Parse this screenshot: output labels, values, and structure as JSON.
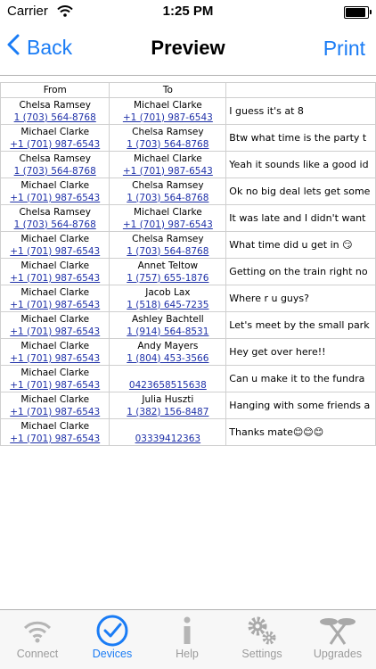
{
  "status_bar": {
    "carrier": "Carrier",
    "time": "1:25 PM"
  },
  "nav": {
    "back_label": "Back",
    "title": "Preview",
    "print_label": "Print"
  },
  "table": {
    "headers": [
      "From",
      "To",
      ""
    ],
    "rows": [
      {
        "from_name": "Chelsa Ramsey",
        "from_number": "1 (703) 564-8768",
        "to_name": "Michael Clarke",
        "to_number": "+1 (701) 987-6543",
        "message": "I guess it's at 8"
      },
      {
        "from_name": "Michael Clarke",
        "from_number": "+1 (701) 987-6543",
        "to_name": "Chelsa Ramsey",
        "to_number": "1 (703) 564-8768",
        "message": "Btw what time is the party t"
      },
      {
        "from_name": "Chelsa Ramsey",
        "from_number": "1 (703) 564-8768",
        "to_name": "Michael Clarke",
        "to_number": "+1 (701) 987-6543",
        "message": "Yeah it sounds like a good id"
      },
      {
        "from_name": "Michael Clarke",
        "from_number": "+1 (701) 987-6543",
        "to_name": "Chelsa Ramsey",
        "to_number": "1 (703) 564-8768",
        "message": "Ok no big deal lets get some"
      },
      {
        "from_name": "Chelsa Ramsey",
        "from_number": "1 (703) 564-8768",
        "to_name": "Michael Clarke",
        "to_number": "+1 (701) 987-6543",
        "message": "It was late and I didn't want"
      },
      {
        "from_name": "Michael Clarke",
        "from_number": "+1 (701) 987-6543",
        "to_name": "Chelsa Ramsey",
        "to_number": "1 (703) 564-8768",
        "message": "What time did u get in 😏"
      },
      {
        "from_name": "Michael Clarke",
        "from_number": "+1 (701) 987-6543",
        "to_name": "Annet Teltow",
        "to_number": "1 (757) 655-1876",
        "message": "Getting on the train right no"
      },
      {
        "from_name": "Michael Clarke",
        "from_number": "+1 (701) 987-6543",
        "to_name": "Jacob Lax",
        "to_number": "1 (518) 645-7235",
        "message": "Where r u guys?"
      },
      {
        "from_name": "Michael Clarke",
        "from_number": "+1 (701) 987-6543",
        "to_name": "Ashley Bachtell",
        "to_number": "1 (914) 564-8531",
        "message": "Let's meet by the small park"
      },
      {
        "from_name": "Michael Clarke",
        "from_number": "+1 (701) 987-6543",
        "to_name": "Andy Mayers",
        "to_number": "1 (804) 453-3566",
        "message": "Hey get over here!!"
      },
      {
        "from_name": "Michael Clarke",
        "from_number": "+1 (701) 987-6543",
        "to_name": "",
        "to_number": "0423658515638",
        "message": "Can u make it to the fundra"
      },
      {
        "from_name": "Michael Clarke",
        "from_number": "+1 (701) 987-6543",
        "to_name": "Julia Huszti",
        "to_number": "1 (382) 156-8487",
        "message": "Hanging with some friends a"
      },
      {
        "from_name": "Michael Clarke",
        "from_number": "+1 (701) 987-6543",
        "to_name": "",
        "to_number": "03339412363",
        "message": "Thanks mate😊😊😊"
      }
    ]
  },
  "tabs": [
    {
      "label": "Connect",
      "icon": "wifi-icon",
      "active": false
    },
    {
      "label": "Devices",
      "icon": "checkmark-circle-icon",
      "active": true
    },
    {
      "label": "Help",
      "icon": "info-icon",
      "active": false
    },
    {
      "label": "Settings",
      "icon": "gears-icon",
      "active": false
    },
    {
      "label": "Upgrades",
      "icon": "upgrades-icon",
      "active": false
    }
  ],
  "colors": {
    "accent": "#1a7cf5",
    "link": "#1f31a8",
    "tab_inactive": "#9b9b9b"
  }
}
